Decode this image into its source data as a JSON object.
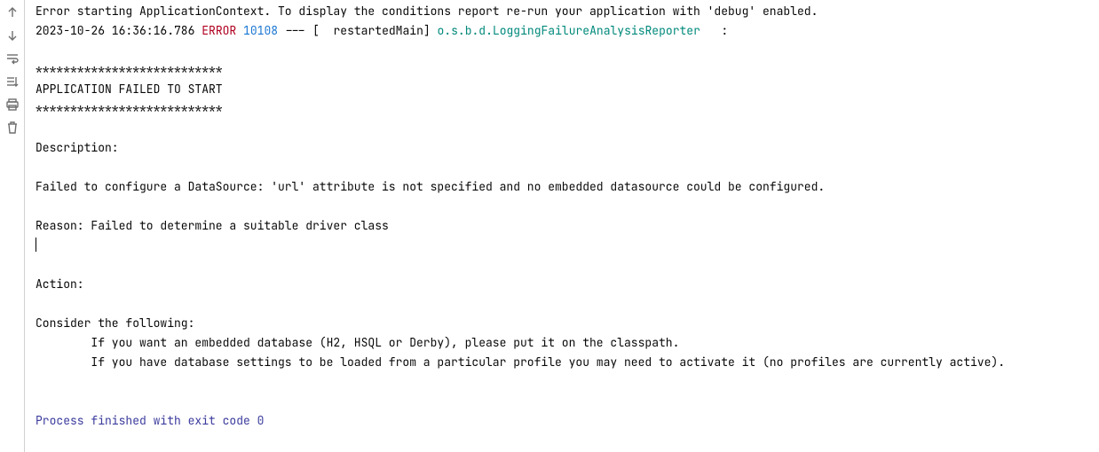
{
  "toolbar": {
    "icons": [
      {
        "name": "arrow-up-icon"
      },
      {
        "name": "arrow-down-icon"
      },
      {
        "name": "soft-wrap-icon"
      },
      {
        "name": "scroll-end-icon"
      },
      {
        "name": "print-icon"
      },
      {
        "name": "trash-icon"
      }
    ]
  },
  "console": {
    "line1": "Error starting ApplicationContext. To display the conditions report re-run your application with 'debug' enabled.",
    "log": {
      "timestamp": "2023-10-26 16:36:16.786",
      "level": "ERROR",
      "pid": "10108",
      "sep": " --- [",
      "thread": "  restartedMain",
      "sep2": "] ",
      "logger": "o.s.b.d.LoggingFailureAnalysisReporter  ",
      "colon": " : "
    },
    "blank1": "",
    "stars1": "***************************",
    "failed": "APPLICATION FAILED TO START",
    "stars2": "***************************",
    "blank2": "",
    "descHdr": "Description:",
    "blank3": "",
    "desc": "Failed to configure a DataSource: 'url' attribute is not specified and no embedded datasource could be configured.",
    "blank4": "",
    "reason": "Reason: Failed to determine a suitable driver class",
    "blank5": "",
    "blank6": "",
    "actionHdr": "Action:",
    "blank7": "",
    "consider": "Consider the following:",
    "opt1": "\tIf you want an embedded database (H2, HSQL or Derby), please put it on the classpath.",
    "opt2": "\tIf you have database settings to be loaded from a particular profile you may need to activate it (no profiles are currently active).",
    "blank8": "",
    "blank9": "",
    "exit": "Process finished with exit code 0",
    "blank10": ""
  }
}
